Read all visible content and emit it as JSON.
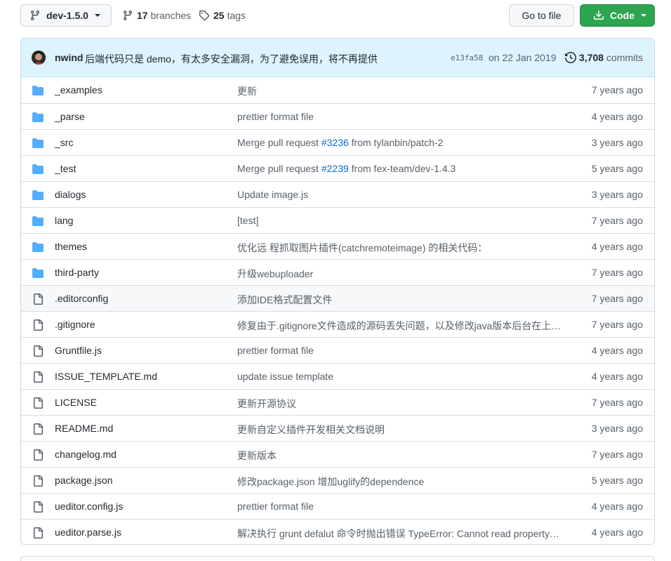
{
  "toolbar": {
    "branch": "dev-1.5.0",
    "branches_count": "17",
    "branches_label": "branches",
    "tags_count": "25",
    "tags_label": "tags",
    "goto_file": "Go to file",
    "code": "Code"
  },
  "commit": {
    "author": "nwind",
    "message": "后端代码只是 demo，有太多安全漏洞，为了避免误用，将不再提供",
    "sha": "e13fa58",
    "date": "on 22 Jan 2019",
    "commits_count": "3,708",
    "commits_label": "commits"
  },
  "colors": {
    "folder": "#54aeff",
    "file": "#57606a",
    "link": "#0969da",
    "primary": "#2da44e"
  },
  "files": [
    {
      "type": "folder",
      "name": "_examples",
      "message": "更新",
      "age": "7 years ago"
    },
    {
      "type": "folder",
      "name": "_parse",
      "message": "prettier format file",
      "age": "4 years ago"
    },
    {
      "type": "folder",
      "name": "_src",
      "message_pre": "Merge pull request ",
      "issue": "#3236",
      "message_post": " from tylanbin/patch-2",
      "age": "3 years ago"
    },
    {
      "type": "folder",
      "name": "_test",
      "message_pre": "Merge pull request ",
      "issue": "#2239",
      "message_post": " from fex-team/dev-1.4.3",
      "age": "5 years ago"
    },
    {
      "type": "folder",
      "name": "dialogs",
      "message": "Update image.js",
      "age": "3 years ago"
    },
    {
      "type": "folder",
      "name": "lang",
      "message": "[test]",
      "age": "7 years ago"
    },
    {
      "type": "folder",
      "name": "themes",
      "message": "优化远 程抓取图片插件(catchremoteimage) 的相关代码：",
      "age": "4 years ago"
    },
    {
      "type": "folder",
      "name": "third-party",
      "message": "升级webuploader",
      "age": "7 years ago"
    },
    {
      "type": "file",
      "name": ".editorconfig",
      "message": "添加IDE格式配置文件",
      "age": "7 years ago"
    },
    {
      "type": "file",
      "name": ".gitignore",
      "message": "修复由于.gitignore文件造成的源码丢失问题，以及修改java版本后台在上…",
      "age": "7 years ago"
    },
    {
      "type": "file",
      "name": "Gruntfile.js",
      "message": "prettier format file",
      "age": "4 years ago"
    },
    {
      "type": "file",
      "name": "ISSUE_TEMPLATE.md",
      "message": "update issue template",
      "age": "4 years ago"
    },
    {
      "type": "file",
      "name": "LICENSE",
      "message": "更新开源协议",
      "age": "7 years ago"
    },
    {
      "type": "file",
      "name": "README.md",
      "message": "更新自定义插件开发相关文档说明",
      "age": "3 years ago"
    },
    {
      "type": "file",
      "name": "changelog.md",
      "message": "更新版本",
      "age": "7 years ago"
    },
    {
      "type": "file",
      "name": "package.json",
      "message": "修改package.json 增加uglify的dependence",
      "age": "5 years ago"
    },
    {
      "type": "file",
      "name": "ueditor.config.js",
      "message": "prettier format file",
      "age": "4 years ago"
    },
    {
      "type": "file",
      "name": "ueditor.parse.js",
      "message": "解决执行 grunt defalut 命令时抛出错误 TypeError: Cannot read property …",
      "age": "4 years ago"
    }
  ]
}
